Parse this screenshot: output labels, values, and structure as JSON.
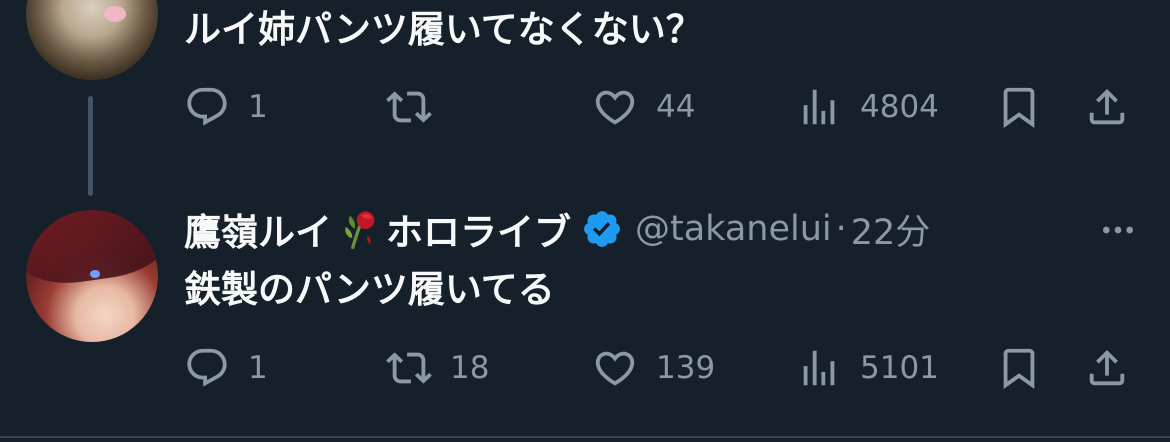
{
  "tweets": [
    {
      "text": "ルイ姉パンツ履いてなくない？",
      "stats": {
        "replies": "1",
        "retweets": "",
        "likes": "44",
        "views": "4804"
      }
    },
    {
      "display_name_part1": "鷹嶺ルイ",
      "display_name_part2": "ホロライブ",
      "handle": "@takanelui",
      "separator": "·",
      "time": "22分",
      "text": "鉄製のパンツ履いてる",
      "stats": {
        "replies": "1",
        "retweets": "18",
        "likes": "139",
        "views": "5101"
      }
    }
  ],
  "icons": [
    "reply-icon",
    "retweet-icon",
    "like-icon",
    "views-icon",
    "bookmark-icon",
    "share-icon",
    "verified-badge-icon",
    "more-icon",
    "rose-emoji-icon"
  ],
  "colors": {
    "background": "#15202b",
    "text": "#f7f9f9",
    "muted": "#8b98a5",
    "verified": "#1d9bf0",
    "thread_line": "#425466"
  }
}
